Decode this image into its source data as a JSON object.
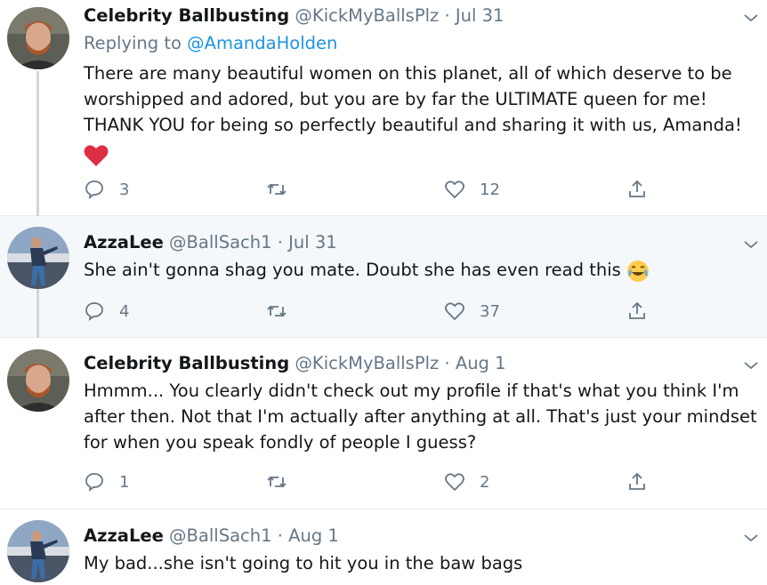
{
  "tweets": [
    {
      "name": "Celebrity Ballbusting",
      "handle": "@KickMyBallsPlz",
      "date": "Jul 31",
      "replying_prefix": "Replying to",
      "replying_to": "@AmandaHolden",
      "lines": [
        "There are many beautiful women on this planet, all of which deserve to be",
        "worshipped and adored, but you are by far the ULTIMATE queen for me!",
        "THANK YOU for being so perfectly beautiful and sharing it with us, Amanda!"
      ],
      "emoji": "red-heart",
      "replies": "3",
      "retweets": "",
      "likes": "12"
    },
    {
      "name": "AzzaLee",
      "handle": "@BallSach1",
      "date": "Jul 31",
      "lines": [
        "She ain't gonna shag you mate. Doubt she has even read this"
      ],
      "emoji": "face-with-tears-of-joy",
      "replies": "4",
      "retweets": "",
      "likes": "37"
    },
    {
      "name": "Celebrity Ballbusting",
      "handle": "@KickMyBallsPlz",
      "date": "Aug 1",
      "lines": [
        "Hmmm... You clearly didn't check out my profile if that's what you think I'm",
        "after then. Not that I'm actually after anything at all. That's just your mindset",
        "for when you speak fondly of people I guess?"
      ],
      "replies": "1",
      "retweets": "",
      "likes": "2"
    },
    {
      "name": "AzzaLee",
      "handle": "@BallSach1",
      "date": "Aug 1",
      "lines": [
        "My bad...she isn't going to hit you in the baw bags"
      ]
    }
  ],
  "separator": "·",
  "colors": {
    "accent": "#1b95e0",
    "muted": "#657786",
    "text": "#14171a",
    "thread": "#ccd6dd",
    "heart": "#e0245e"
  }
}
